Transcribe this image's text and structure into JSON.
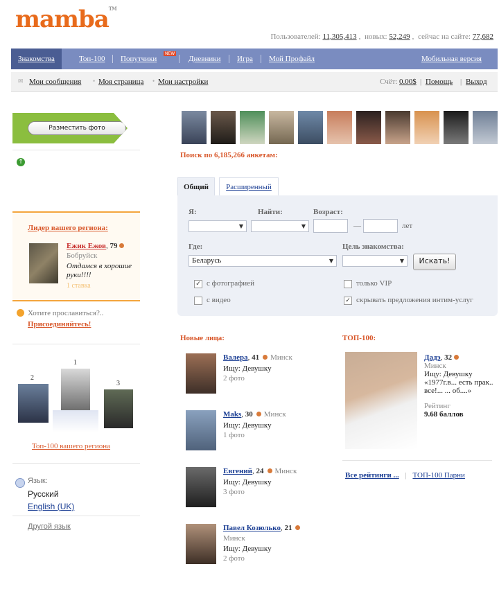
{
  "brand": {
    "logo": "mamba",
    "tm": "TM",
    "accent": "#e86b1c"
  },
  "stats": {
    "users_label": "Пользователей:",
    "users": "11,305,413",
    "new_label": "новых:",
    "new": "52,249",
    "online_label": "сейчас на сайте:",
    "online": "77,682"
  },
  "nav": {
    "items": [
      "Знакомства",
      "Топ-100",
      "Попутчики",
      "Дневники",
      "Игра",
      "Мой Профайл"
    ],
    "new_badge": "NEW",
    "mobile": "Мобильная версия"
  },
  "subnav": {
    "items": [
      "Мои сообщения",
      "Моя страница",
      "Мои настройки"
    ],
    "account_label": "Счёт:",
    "account_value": "0.00$",
    "help": "Помощь",
    "logout": "Выход"
  },
  "left": {
    "place_photo": "Разместить фото",
    "leader": {
      "title": "Лидер вашего региона:",
      "name": "Ежик Ежов",
      "age": "79",
      "city": "Бобруйск",
      "status": "Отдамся в хорошие руки!!!!",
      "stake": "1 ставка"
    },
    "glory": {
      "question": "Хотите прославиться?..",
      "join": "Присоединяйтесь!"
    },
    "podium": {
      "n1": "1",
      "n2": "2",
      "n3": "3"
    },
    "top100_region": "Топ-100 вашего региона",
    "lang": {
      "label": "Язык:",
      "current": "Русский",
      "english": "English (UK)",
      "other": "Другой язык"
    }
  },
  "search": {
    "count_text": "Поиск по 6,185,266 анкетам:",
    "tabs": {
      "basic": "Общий",
      "extended": "Расширенный"
    },
    "labels": {
      "i": "Я:",
      "find": "Найти:",
      "age": "Возраст:",
      "years": "лет",
      "dash": "—",
      "where": "Где:",
      "goal": "Цель знакомства:"
    },
    "where_value": "Беларусь",
    "button": "Искать!",
    "checks": [
      {
        "label": "с фотографией",
        "checked": true
      },
      {
        "label": "с видео",
        "checked": false
      },
      {
        "label": "только VIP",
        "checked": false
      },
      {
        "label": "скрывать предложения интим-услуг",
        "checked": true
      }
    ]
  },
  "new_faces": {
    "title": "Новые лица:",
    "items": [
      {
        "name": "Валера",
        "age": "41",
        "city": "Минск",
        "seek": "Ищу: Девушку",
        "photos": "2 фото"
      },
      {
        "name": "Maks",
        "age": "30",
        "city": "Минск",
        "seek": "Ищу: Девушку",
        "photos": "1 фото"
      },
      {
        "name": "Евгений",
        "age": "24",
        "city": "Минск",
        "seek": "Ищу: Девушку",
        "photos": "3 фото"
      },
      {
        "name": "Павел Козюлько",
        "age": "21",
        "city": "Минск",
        "seek": "Ищу: Девушку",
        "photos": "2 фото"
      }
    ]
  },
  "top100": {
    "title": "ТОП-100:",
    "name": "Дадэ",
    "age": "32",
    "city": "Минск",
    "seek": "Ищу: Девушку",
    "quote": "«1977г.в... есть прак.. все!... ... об....»",
    "rating_label": "Рейтинг",
    "rating": "9.68 баллов",
    "all_ratings": "Все рейтинги ...",
    "top_guys": "ТОП-100 Парни"
  }
}
